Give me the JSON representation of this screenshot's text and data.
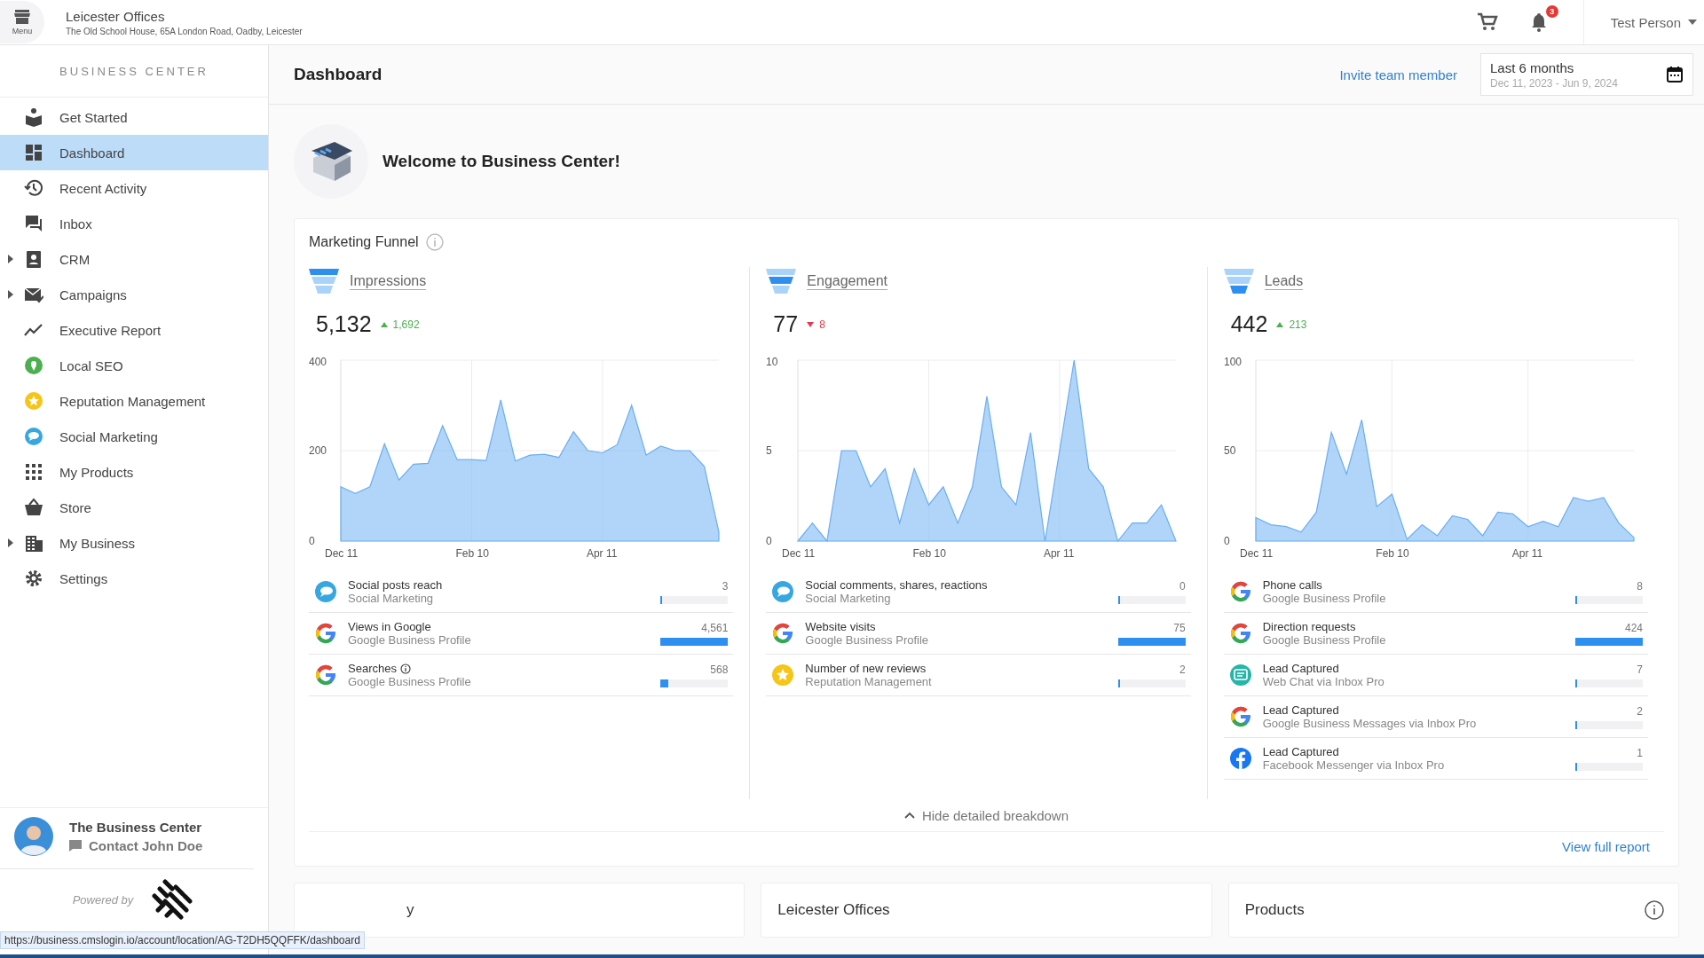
{
  "top_bar": {
    "menu_label": "Menu",
    "location_name": "Leicester Offices",
    "location_address": "The Old School House, 65A London Road, Oadby, Leicester",
    "notification_count": "3",
    "user_name": "Test Person"
  },
  "sidebar": {
    "heading": "BUSINESS CENTER",
    "items": [
      {
        "label": "Get Started",
        "selected": false,
        "expandable": false
      },
      {
        "label": "Dashboard",
        "selected": true,
        "expandable": false
      },
      {
        "label": "Recent Activity",
        "selected": false,
        "expandable": false
      },
      {
        "label": "Inbox",
        "selected": false,
        "expandable": false
      },
      {
        "label": "CRM",
        "selected": false,
        "expandable": true
      },
      {
        "label": "Campaigns",
        "selected": false,
        "expandable": true
      },
      {
        "label": "Executive Report",
        "selected": false,
        "expandable": false
      },
      {
        "label": "Local SEO",
        "selected": false,
        "expandable": false
      },
      {
        "label": "Reputation Management",
        "selected": false,
        "expandable": false
      },
      {
        "label": "Social Marketing",
        "selected": false,
        "expandable": false
      },
      {
        "label": "My Products",
        "selected": false,
        "expandable": false
      },
      {
        "label": "Store",
        "selected": false,
        "expandable": false
      },
      {
        "label": "My Business",
        "selected": false,
        "expandable": true
      },
      {
        "label": "Settings",
        "selected": false,
        "expandable": false
      }
    ],
    "contact": {
      "business": "The Business Center",
      "contact_label": "Contact John Doe"
    },
    "powered_by": "Powered by"
  },
  "header": {
    "title": "Dashboard",
    "invite_link": "Invite team member",
    "date_range": {
      "label": "Last 6 months",
      "dates": "Dec 11, 2023 - Jun 9, 2024"
    }
  },
  "welcome": {
    "title": "Welcome to Business Center!"
  },
  "marketing_funnel": {
    "title": "Marketing Funnel",
    "columns": [
      {
        "name": "Impressions",
        "total": "5,132",
        "delta": "1,692",
        "rising": true,
        "chart_data": {
          "type": "area",
          "grid": true,
          "yticks": [
            0,
            200,
            400
          ],
          "ylim": [
            0,
            400
          ],
          "categories": [
            "Dec 11",
            null,
            null,
            null,
            null,
            null,
            null,
            null,
            null,
            "Feb 10",
            null,
            null,
            null,
            null,
            null,
            null,
            null,
            null,
            "Apr 11",
            null,
            null,
            null,
            null,
            null,
            null,
            null,
            null
          ],
          "series": [
            {
              "color": "#8fc3f5",
              "values": [
                120,
                105,
                120,
                215,
                135,
                170,
                172,
                255,
                180,
                180,
                178,
                312,
                177,
                190,
                192,
                185,
                242,
                200,
                195,
                213,
                300,
                190,
                210,
                200,
                200,
                165,
                20
              ]
            }
          ]
        },
        "metrics": [
          {
            "label": "Social posts reach",
            "source": "Social Marketing",
            "value": "3",
            "level": 0.001,
            "kind": "social",
            "info": false
          },
          {
            "label": "Views in Google",
            "source": "Google Business Profile",
            "value": "4,561",
            "level": 1,
            "kind": "google",
            "info": false
          },
          {
            "label": "Searches",
            "source": "Google Business Profile",
            "value": "568",
            "level": 0.12,
            "kind": "google",
            "info": true
          }
        ]
      },
      {
        "name": "Engagement",
        "total": "77",
        "delta": "8",
        "rising": false,
        "chart_data": {
          "type": "area",
          "grid": true,
          "yticks": [
            0,
            5,
            10
          ],
          "ylim": [
            0,
            10
          ],
          "categories": [
            "Dec 11",
            null,
            null,
            null,
            null,
            null,
            null,
            null,
            null,
            "Feb 10",
            null,
            null,
            null,
            null,
            null,
            null,
            null,
            null,
            "Apr 11",
            null,
            null,
            null,
            null,
            null,
            null,
            null,
            null
          ],
          "series": [
            {
              "color": "#8fc3f5",
              "values": [
                0,
                1,
                0,
                5,
                5,
                3,
                4,
                1,
                4,
                2,
                3,
                1,
                3,
                8,
                3,
                2,
                6,
                0,
                5,
                10,
                4,
                3,
                0,
                1,
                1,
                2,
                0
              ]
            }
          ]
        },
        "metrics": [
          {
            "label": "Social comments, shares, reactions",
            "source": "Social Marketing",
            "value": "0",
            "level": 0,
            "kind": "social",
            "info": false
          },
          {
            "label": "Website visits",
            "source": "Google Business Profile",
            "value": "75",
            "level": 1,
            "kind": "google",
            "info": false
          },
          {
            "label": "Number of new reviews",
            "source": "Reputation Management",
            "value": "2",
            "level": 0.03,
            "kind": "star",
            "info": false
          }
        ]
      },
      {
        "name": "Leads",
        "total": "442",
        "delta": "213",
        "rising": true,
        "chart_data": {
          "type": "area",
          "grid": true,
          "yticks": [
            0,
            50,
            100
          ],
          "ylim": [
            0,
            100
          ],
          "categories": [
            "Dec 11",
            null,
            null,
            null,
            null,
            null,
            null,
            null,
            null,
            "Feb 10",
            null,
            null,
            null,
            null,
            null,
            null,
            null,
            null,
            "Apr 11",
            null,
            null,
            null,
            null,
            null,
            null,
            null
          ],
          "series": [
            {
              "color": "#8fc3f5",
              "values": [
                13,
                9,
                8,
                5,
                16,
                60,
                37,
                67,
                19,
                26,
                1,
                9,
                3,
                14,
                12,
                3,
                16,
                15,
                8,
                11,
                8,
                24,
                22,
                24,
                10,
                2
              ]
            }
          ]
        },
        "metrics": [
          {
            "label": "Phone calls",
            "source": "Google Business Profile",
            "value": "8",
            "level": 0.02,
            "kind": "google",
            "info": false
          },
          {
            "label": "Direction requests",
            "source": "Google Business Profile",
            "value": "424",
            "level": 1,
            "kind": "google",
            "info": false
          },
          {
            "label": "Lead Captured",
            "source": "Web Chat via Inbox Pro",
            "value": "7",
            "level": 0.02,
            "kind": "webchat",
            "info": false
          },
          {
            "label": "Lead Captured",
            "source": "Google Business Messages via Inbox Pro",
            "value": "2",
            "level": 0.004,
            "kind": "google",
            "info": false
          },
          {
            "label": "Lead Captured",
            "source": "Facebook Messenger via Inbox Pro",
            "value": "1",
            "level": 0.002,
            "kind": "facebook",
            "info": false
          }
        ]
      }
    ],
    "toggle_label": "Hide detailed breakdown",
    "report_link": "View full report"
  },
  "bottom_cards": [
    {
      "title": "y",
      "info": false
    },
    {
      "title": "Leicester Offices",
      "info": false
    },
    {
      "title": "Products",
      "info": true
    }
  ],
  "status_url": "https://business.cmslogin.io/account/location/AG-T2DH5QQFFK/dashboard"
}
